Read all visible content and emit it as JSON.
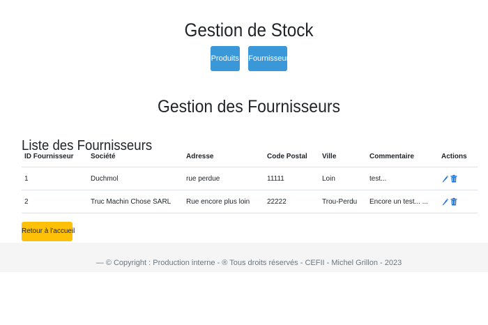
{
  "header": {
    "title": "Gestion de Stock"
  },
  "nav": {
    "items": [
      {
        "label": "Produits"
      },
      {
        "label": "Fournisseurs"
      }
    ],
    "button_color": "#3a97d8"
  },
  "main": {
    "heading": "Gestion des Fournisseurs",
    "list_title": "Liste des Fournisseurs",
    "table": {
      "columns": [
        "ID Fournisseur",
        "Société",
        "Adresse",
        "Code Postal",
        "Ville",
        "Commentaire",
        "Actions"
      ],
      "rows": [
        {
          "id": "1",
          "societe": "Duchmol",
          "adresse": "rue perdue",
          "code_postal": "11111",
          "ville": "Loin",
          "commentaire": "test..."
        },
        {
          "id": "2",
          "societe": "Truc Machin Chose SARL",
          "adresse": "Rue encore plus loin",
          "code_postal": "22222",
          "ville": "Trou-Perdu",
          "commentaire": "Encore un test... ..."
        }
      ],
      "action_icons": [
        "pencil-icon",
        "trash-icon"
      ],
      "icon_color": "#1e6fd9"
    },
    "home_button": {
      "label": "Retour à l'accueil",
      "color": "#ffc107"
    }
  },
  "footer": {
    "text": "— © Copyright : Production interne - ® Tous droits réservés - CEFII - Michel Grillon - 2023"
  }
}
